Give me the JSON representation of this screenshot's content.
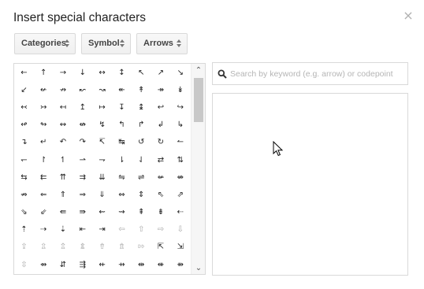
{
  "dialog": {
    "title": "Insert special characters",
    "close": "×"
  },
  "dropdowns": [
    {
      "label": "Categories"
    },
    {
      "label": "Symbol"
    },
    {
      "label": "Arrows"
    }
  ],
  "search": {
    "placeholder": "Search by keyword (e.g. arrow) or codepoint",
    "value": ""
  },
  "scrollbar": {
    "up": "⌃",
    "down": "⌄"
  },
  "grid": {
    "rows": [
      [
        "←",
        "↑",
        "→",
        "↓",
        "↔",
        "↕",
        "↖",
        "↗",
        "↘"
      ],
      [
        "↙",
        "↚",
        "↛",
        "↜",
        "↝",
        "↞",
        "↟",
        "↠",
        "↡"
      ],
      [
        "↢",
        "↣",
        "↤",
        "↥",
        "↦",
        "↧",
        "↨",
        "↩",
        "↪"
      ],
      [
        "↫",
        "↬",
        "↭",
        "↮",
        "↯",
        "↰",
        "↱",
        "↲",
        "↳"
      ],
      [
        "↴",
        "↵",
        "↶",
        "↷",
        "↸",
        "↹",
        "↺",
        "↻",
        "↼"
      ],
      [
        "↽",
        "↾",
        "↿",
        "⇀",
        "⇁",
        "⇂",
        "⇃",
        "⇄",
        "⇅"
      ],
      [
        "⇆",
        "⇇",
        "⇈",
        "⇉",
        "⇊",
        "⇋",
        "⇌",
        "⇍",
        "⇎"
      ],
      [
        "⇏",
        "⇐",
        "⇑",
        "⇒",
        "⇓",
        "⇔",
        "⇕",
        "⇖",
        "⇗"
      ],
      [
        "⇘",
        "⇙",
        "⇚",
        "⇛",
        "⇜",
        "⇝",
        "⇞",
        "⇟",
        "⇠"
      ],
      [
        "⇡",
        "⇢",
        "⇣",
        "⇤",
        "⇥",
        "⇦",
        "⇧",
        "⇨",
        "⇩"
      ],
      [
        "⇪",
        "⇫",
        "⇬",
        "⇭",
        "⇮",
        "⇯",
        "⇰",
        "⇱",
        "⇲"
      ],
      [
        "⇳",
        "⇴",
        "⇵",
        "⇶",
        "⇷",
        "⇸",
        "⇹",
        "⇺",
        "⇻"
      ]
    ],
    "light_cells": [
      "⇦",
      "⇧",
      "⇨",
      "⇩",
      "⇪",
      "⇫",
      "⇬",
      "⇭",
      "⇮",
      "⇯",
      "⇰",
      "⇳"
    ]
  }
}
